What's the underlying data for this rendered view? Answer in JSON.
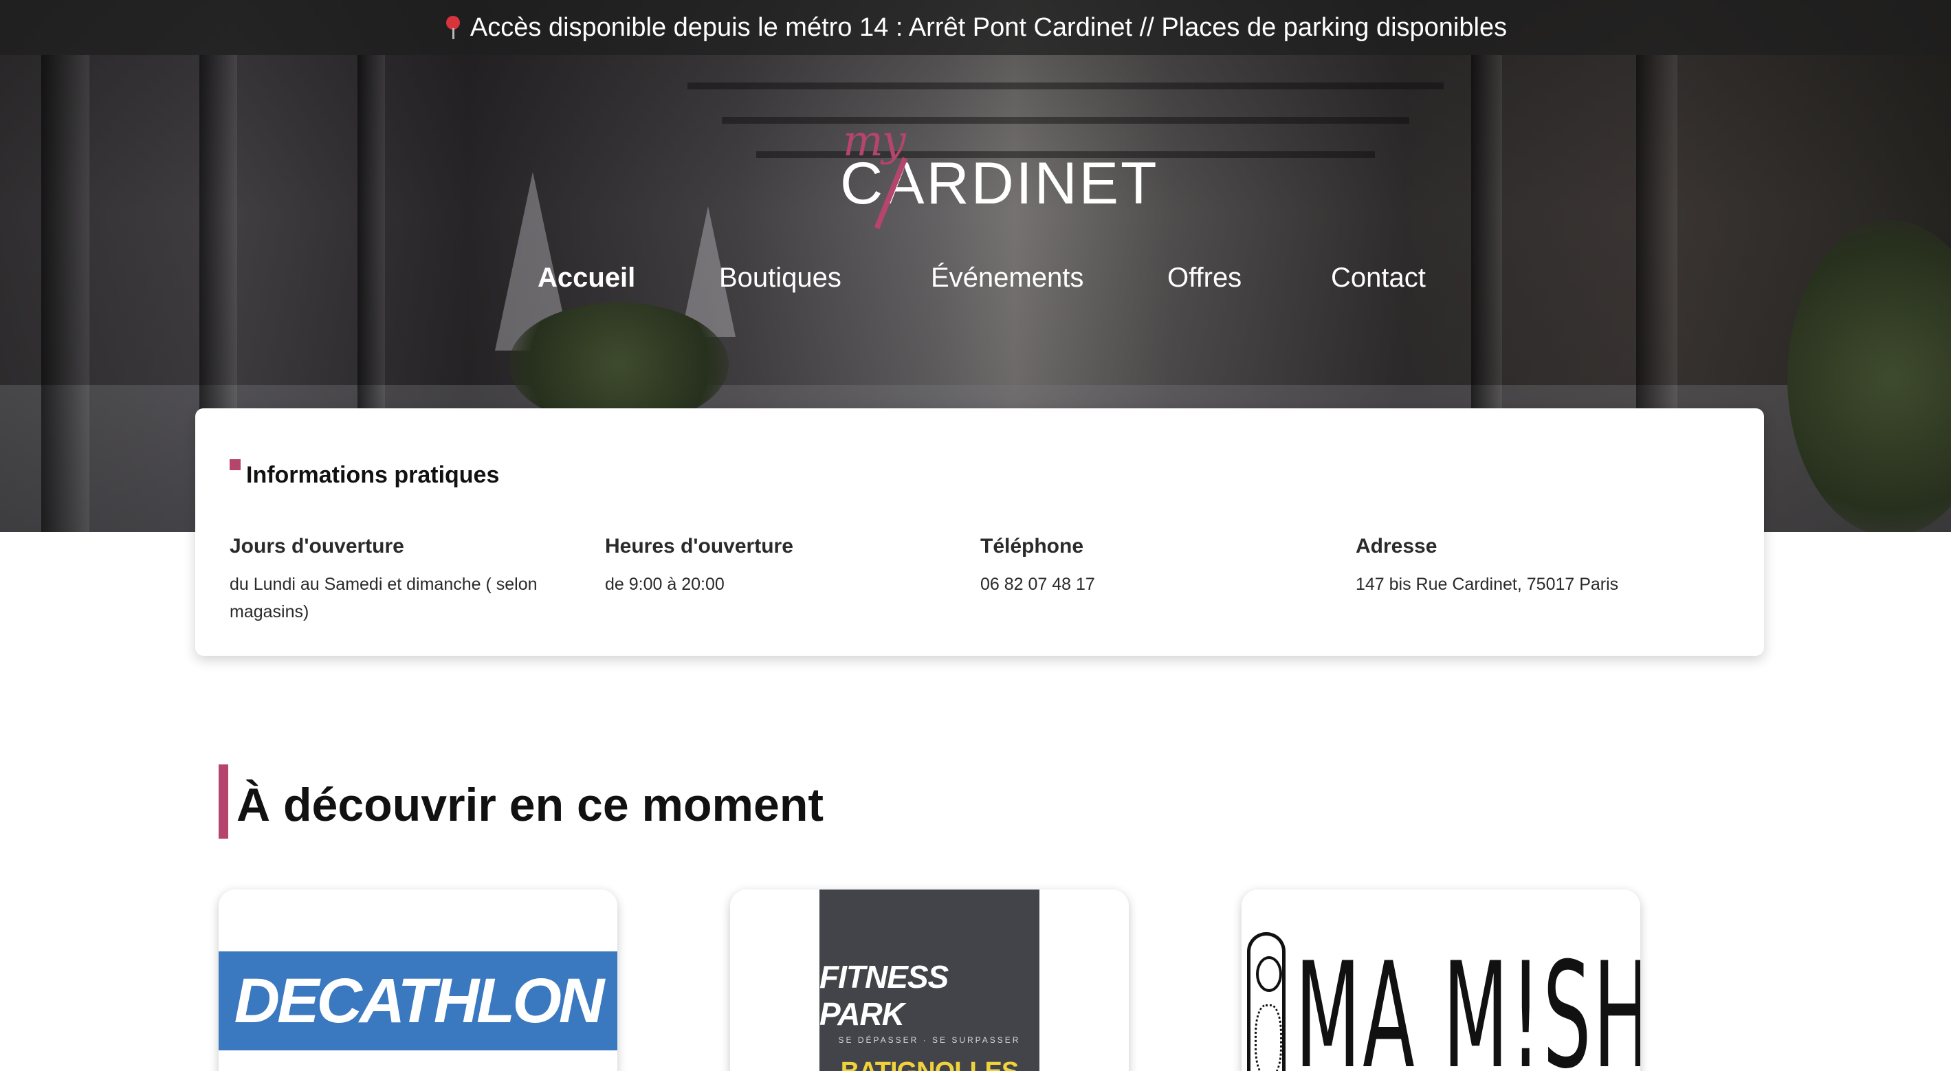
{
  "topbar": {
    "message": "Accès disponible depuis le métro 14 : Arrêt Pont Cardinet // Places de parking disponibles",
    "icon": "map-pin-icon"
  },
  "logo": {
    "script_text": "my",
    "word_text": "CARDINET"
  },
  "nav": {
    "items": [
      {
        "label": "Accueil",
        "active": true
      },
      {
        "label": "Boutiques",
        "active": false
      },
      {
        "label": "Événements",
        "active": false
      },
      {
        "label": "Offres",
        "active": false
      },
      {
        "label": "Contact",
        "active": false
      }
    ]
  },
  "info": {
    "title": "Informations pratiques",
    "columns": [
      {
        "heading": "Jours d'ouverture",
        "value": "du Lundi au Samedi et dimanche ( selon magasins)"
      },
      {
        "heading": "Heures d'ouverture",
        "value": "de 9:00 à 20:00"
      },
      {
        "heading": "Téléphone",
        "value": "06 82 07 48 17"
      },
      {
        "heading": "Adresse",
        "value": "147 bis Rue Cardinet, 75017 Paris"
      }
    ]
  },
  "discover": {
    "title": "À découvrir en ce moment",
    "shops": [
      {
        "name": "DECATHLON",
        "logo_color": "#3a78c0"
      },
      {
        "name": "FITNESS PARK",
        "tagline": "SE DÉPASSER · SE SURPASSER",
        "location": "BATIGNOLLES",
        "logo_color": "#424449"
      },
      {
        "name": "MA M!SHKÂ"
      }
    ]
  },
  "colors": {
    "accent": "#b5456c",
    "topbar_bg": "#1e1e1e",
    "card_bg": "#ffffff"
  }
}
